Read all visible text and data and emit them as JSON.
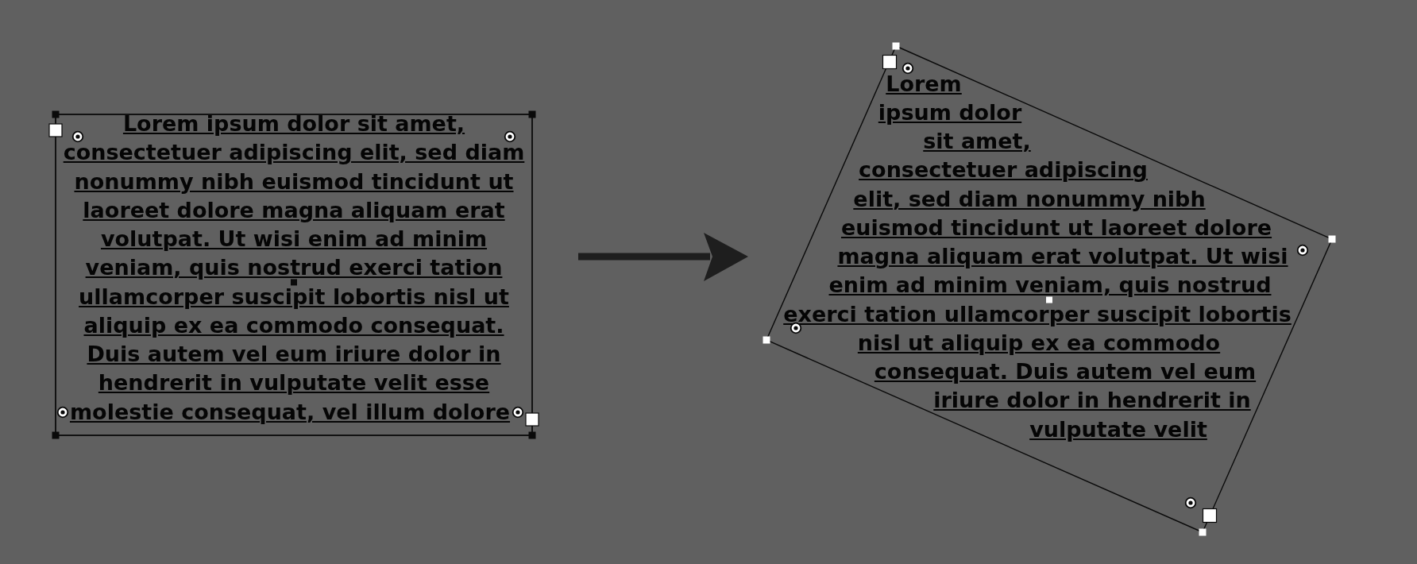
{
  "source_frame": {
    "lines": [
      "Lorem ipsum dolor sit amet,",
      "consectetuer adipiscing elit, sed diam",
      "nonummy nibh euismod tincidunt ut",
      "laoreet dolore magna aliquam erat",
      "volutpat. Ut wisi enim ad minim",
      "veniam, quis nostrud exerci tation",
      "ullamcorper suscipit lobortis nisl ut",
      "aliquip ex ea commodo consequat.",
      "Duis autem vel eum iriure dolor in",
      "hendrerit in vulputate velit esse",
      "molestie consequat, vel illum dolore"
    ]
  },
  "transformed_frame": {
    "lines": [
      "Lorem",
      "ipsum dolor",
      "sit amet,",
      "consectetuer adipiscing",
      "elit, sed diam nonummy nibh",
      "euismod tincidunt ut laoreet dolore",
      "magna aliquam erat volutpat. Ut wisi",
      "enim ad minim veniam, quis nostrud",
      "exerci tation ullamcorper suscipit lobortis",
      "nisl ut aliquip ex ea commodo",
      "consequat. Duis autem vel eum",
      "iriure dolor in hendrerit in",
      "vulputate velit"
    ]
  }
}
